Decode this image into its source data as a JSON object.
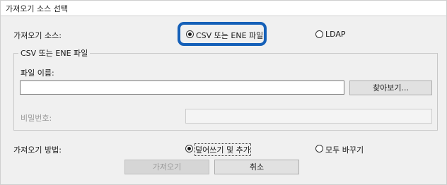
{
  "window": {
    "title": "가져오기 소스 선택"
  },
  "source": {
    "label": "가져오기 소스:",
    "options": [
      {
        "label": "CSV 또는 ENE 파일",
        "selected": true
      },
      {
        "label": "LDAP",
        "selected": false
      }
    ],
    "highlight_color": "#1560b8"
  },
  "file_group": {
    "title": "CSV 또는 ENE 파일",
    "filename_label": "파일 이름:",
    "filename_value": "",
    "browse_button": "찾아보기...",
    "password_label": "비밀번호:",
    "password_value": ""
  },
  "method": {
    "label": "가져오기 방법:",
    "options": [
      {
        "label": "덮어쓰기 및 추가",
        "selected": true
      },
      {
        "label": "모두 바꾸기",
        "selected": false
      }
    ]
  },
  "buttons": {
    "import": "가져오기",
    "cancel": "취소"
  }
}
